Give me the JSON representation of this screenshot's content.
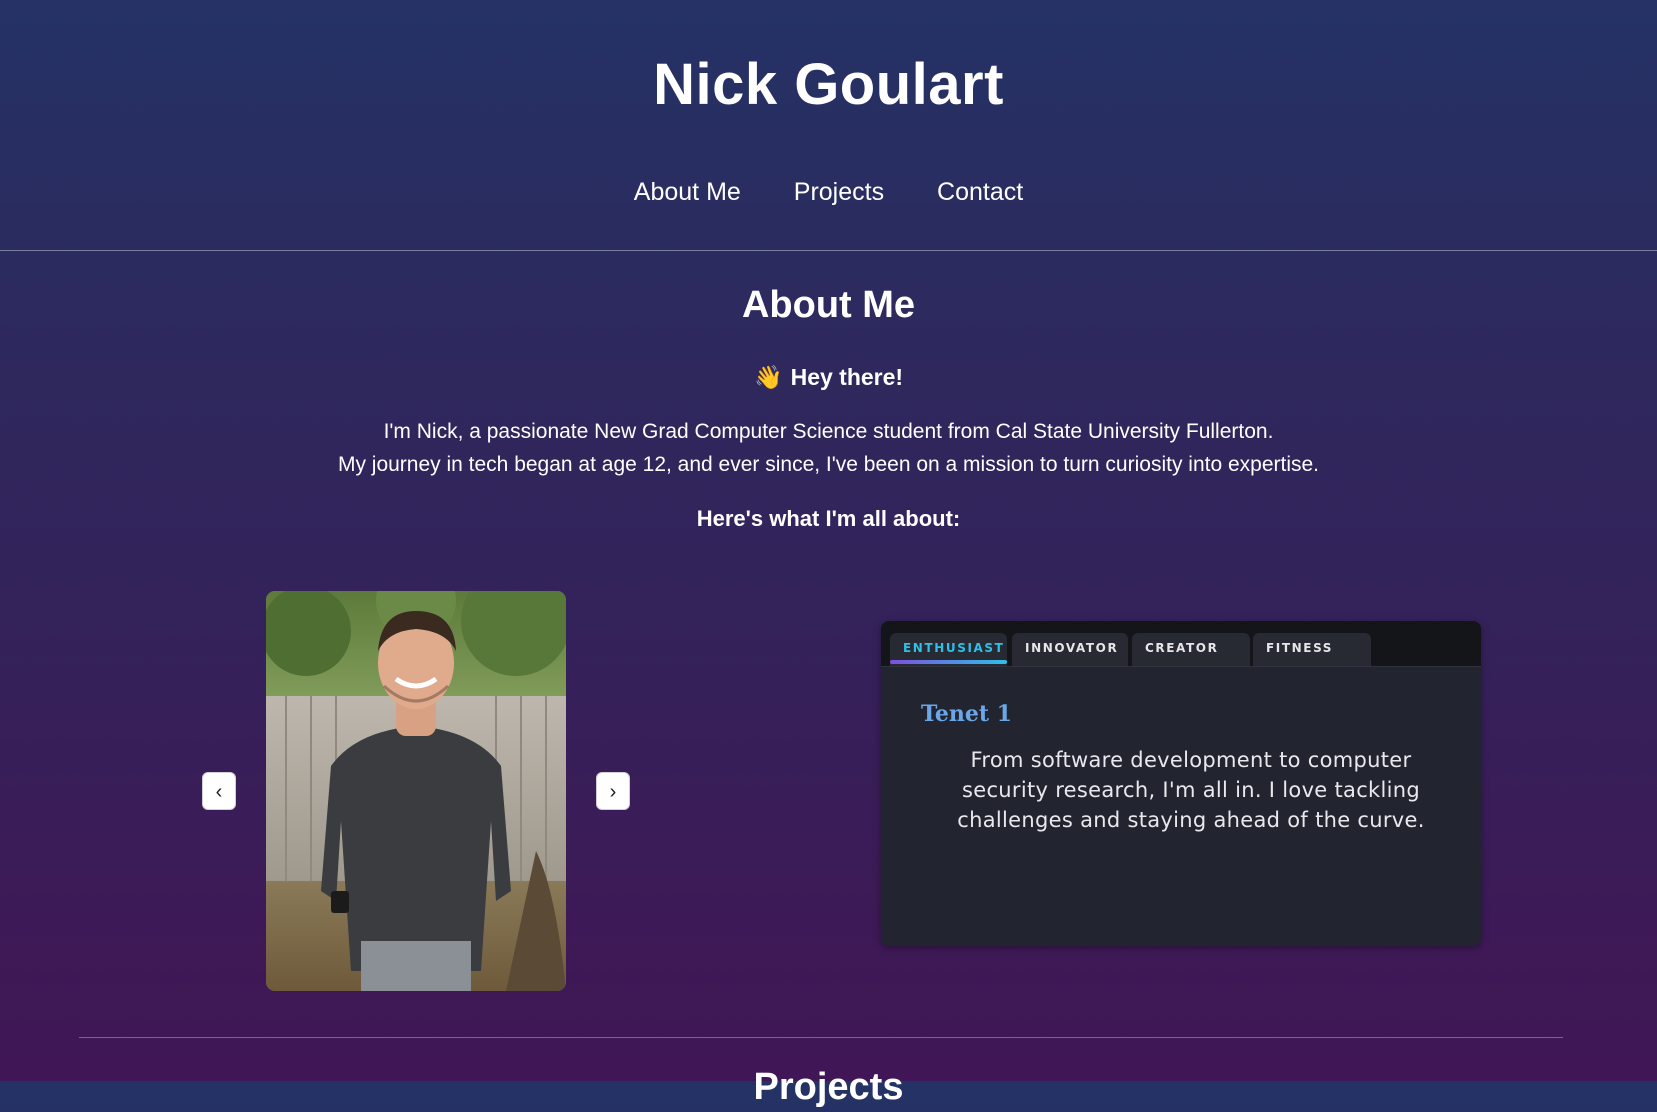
{
  "header": {
    "site_title": "Nick Goulart",
    "nav": {
      "about": "About Me",
      "projects": "Projects",
      "contact": "Contact"
    }
  },
  "about": {
    "heading": "About Me",
    "greeting_icon": "👋",
    "greeting": "Hey there!",
    "intro_line1": "I'm Nick, a passionate New Grad Computer Science student from Cal State University Fullerton.",
    "intro_line2": "My journey in tech began at age 12, and ever since, I've been on a mission to turn curiosity into expertise.",
    "subheading": "Here's what I'm all about:"
  },
  "carousel": {
    "prev_label": "‹",
    "next_label": "›",
    "photo_icon": "profile-photo"
  },
  "tenets": {
    "tabs": [
      "ENTHUSIAST",
      "INNOVATOR",
      "CREATOR",
      "FITNESS"
    ],
    "active_tab": "ENTHUSIAST",
    "title": "Tenet 1",
    "body": "From software development to computer security research, I'm all in. I love tackling challenges and staying ahead of the curve."
  },
  "projects": {
    "heading": "Projects"
  },
  "colors": {
    "accent_tab": "#2ec0e8",
    "accent_gradient_start": "#7e4fe0",
    "tenet_title": "#6aa6e8",
    "card_bg": "#22252f"
  }
}
